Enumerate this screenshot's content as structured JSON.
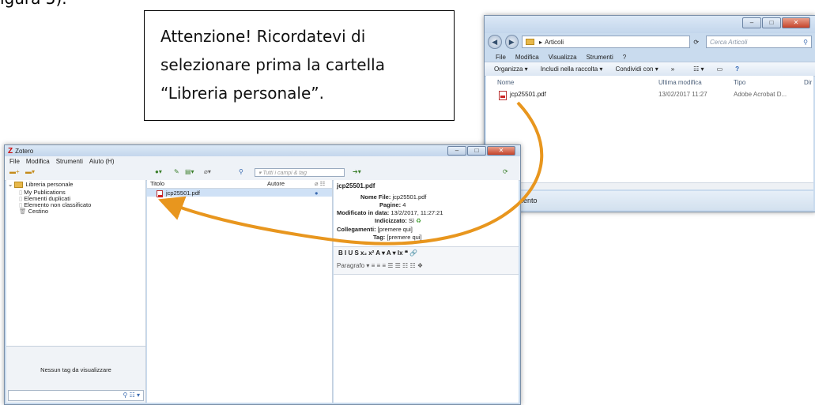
{
  "doc": {
    "top_text": "igura 5).",
    "callout_lines": [
      "Attenzione! Ricordatevi di",
      "selezionare prima la cartella",
      "“Libreria personale”."
    ]
  },
  "explorer": {
    "path": "Articoli",
    "search_placeholder": "Cerca Articoli",
    "menu": [
      "File",
      "Modifica",
      "Visualizza",
      "Strumenti",
      "?"
    ],
    "toolbar": [
      "Organizza ▾",
      "Includi nella raccolta ▾",
      "Condividi con ▾",
      "»"
    ],
    "columns": [
      "Nome",
      "Ultima modifica",
      "Tipo",
      "Dir"
    ],
    "file": {
      "name": "jcp25501.pdf",
      "modified": "13/02/2017 11:27",
      "type": "Adobe Acrobat D..."
    },
    "status": "1 elemento"
  },
  "zotero": {
    "title": "Zotero",
    "menu": [
      "File",
      "Modifica",
      "Strumenti",
      "Aiuto (H)"
    ],
    "filter_placeholder": "▾ Tutti i campi & tag",
    "tree": [
      "Libreria personale",
      "My Publications",
      "Elementi duplicati",
      "Elemento non classificato",
      "Cestino"
    ],
    "tags_message": "Nessun tag da visualizzare",
    "columns": {
      "title": "Titolo",
      "author": "Autore"
    },
    "item": "jcp25501.pdf",
    "info": {
      "heading": "jcp25501.pdf",
      "filename_label": "Nome File:",
      "filename": "jcp25501.pdf",
      "pages_label": "Pagine:",
      "pages": "4",
      "modified_label": "Modificato in data:",
      "modified": "13/2/2017, 11:27:21",
      "indexed_label": "Indicizzato:",
      "indexed": "Sì",
      "links_label": "Collegamenti:",
      "links": "[premere qui]",
      "tag_label": "Tag:",
      "tag": "[premere qui]"
    },
    "editor_row1": "B  I  U  S  x₂  x²  A ▾  A ▾  Ix  ❝  🔗",
    "editor_row2": "Paragrafo  ▾   ≡  ≡  ≡  ☰  ☰  ☷  ☷  ❖"
  },
  "colors": {
    "arrow": "#e8961e",
    "window_frame": "#c9dbee",
    "selection": "#cfe1f6"
  }
}
